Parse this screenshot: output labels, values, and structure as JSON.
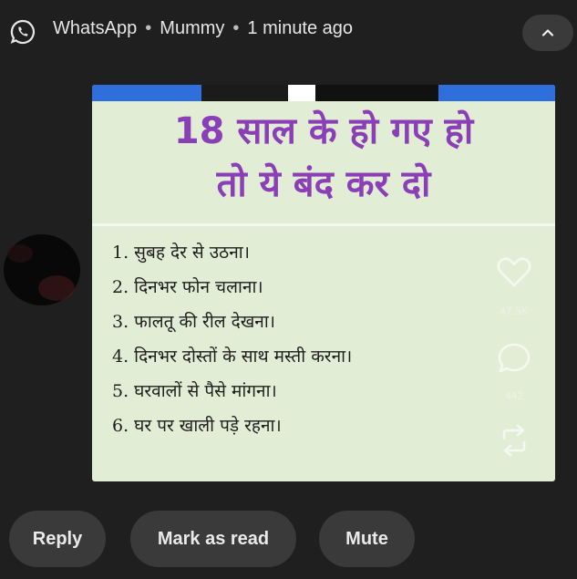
{
  "notification": {
    "app_name": "WhatsApp",
    "separator": "•",
    "sender": "Mummy",
    "time": "1 minute ago"
  },
  "icons": {
    "app": "whatsapp-icon",
    "collapse": "chevron-up-icon",
    "like": "heart-icon",
    "comment": "comment-icon",
    "share": "share-icon"
  },
  "post": {
    "title_line1": "18 साल के हो गए हो",
    "title_line2": "तो ये बंद कर दो",
    "items": [
      "1. सुबह देर से उठना।",
      "2. दिनभर फोन चलाना।",
      "3. फालतू की रील देखना।",
      "4. दिनभर दोस्तों के साथ मस्ती करना।",
      "5. घरवालों से पैसे मांगना।",
      "6. घर पर खाली पड़े रहना।"
    ],
    "likes": "47.5K",
    "comments": "442"
  },
  "actions": {
    "reply": "Reply",
    "mark_read": "Mark as read",
    "mute": "Mute"
  },
  "colors": {
    "background": "#1f1f1f",
    "button": "#3a3a3a",
    "card": "#e2edd6",
    "title": "#8b3fb7",
    "strip_blue": "#2e6fdb"
  }
}
